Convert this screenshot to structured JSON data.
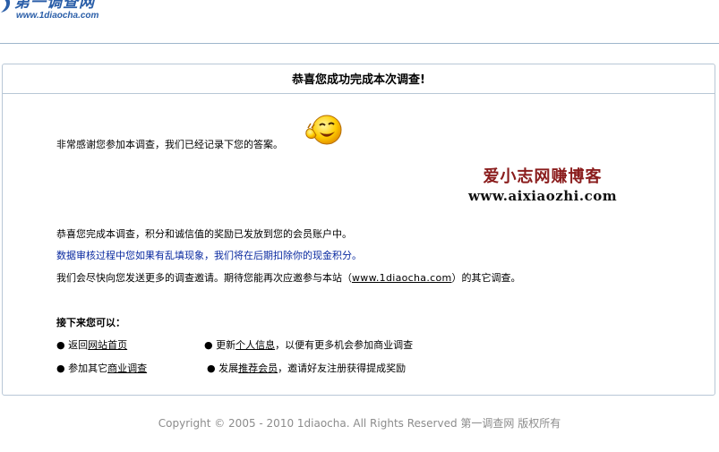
{
  "header": {
    "logo_cn": "第一调查网",
    "logo_url": "www.1diaocha.com"
  },
  "panel": {
    "title": "恭喜您成功完成本次调查!",
    "thanks": "非常感谢您参加本调查，我们已经记录下您的答案。",
    "watermark_cn": "爱小志网赚博客",
    "watermark_url": "www.aixiaozhi.com",
    "line1": "恭喜您完成本调查，积分和诚信值的奖励已发放到您的会员账户中。",
    "line2": "数据审核过程中您如果有乱填现象，我们将在后期扣除你的现金积分。",
    "line3_pre": "我们会尽快向您发送更多的调查邀请。期待您能再次应邀参与本站（",
    "line3_link": "www.1diaocha.com",
    "line3_post": "）的其它调查。",
    "next_title": "接下来您可以：",
    "options": [
      {
        "pre": "● 返回",
        "link": "网站首页",
        "post": ""
      },
      {
        "pre": "● 更新",
        "link": "个人信息",
        "post": "，以便有更多机会参加商业调查"
      },
      {
        "pre": "● 参加其它",
        "link": "商业调查",
        "post": ""
      },
      {
        "pre": "● 发展",
        "link": "推荐会员",
        "post": "，邀请好友注册获得提成奖励"
      }
    ]
  },
  "footer": {
    "copyright": "Copyright © 2005 - 2010 1diaocha. All Rights Reserved   第一调查网 版权所有"
  },
  "colors": {
    "brand": "#2a5ea8",
    "warning_text": "#0a2aa0",
    "watermark": "#8a1c1c"
  }
}
